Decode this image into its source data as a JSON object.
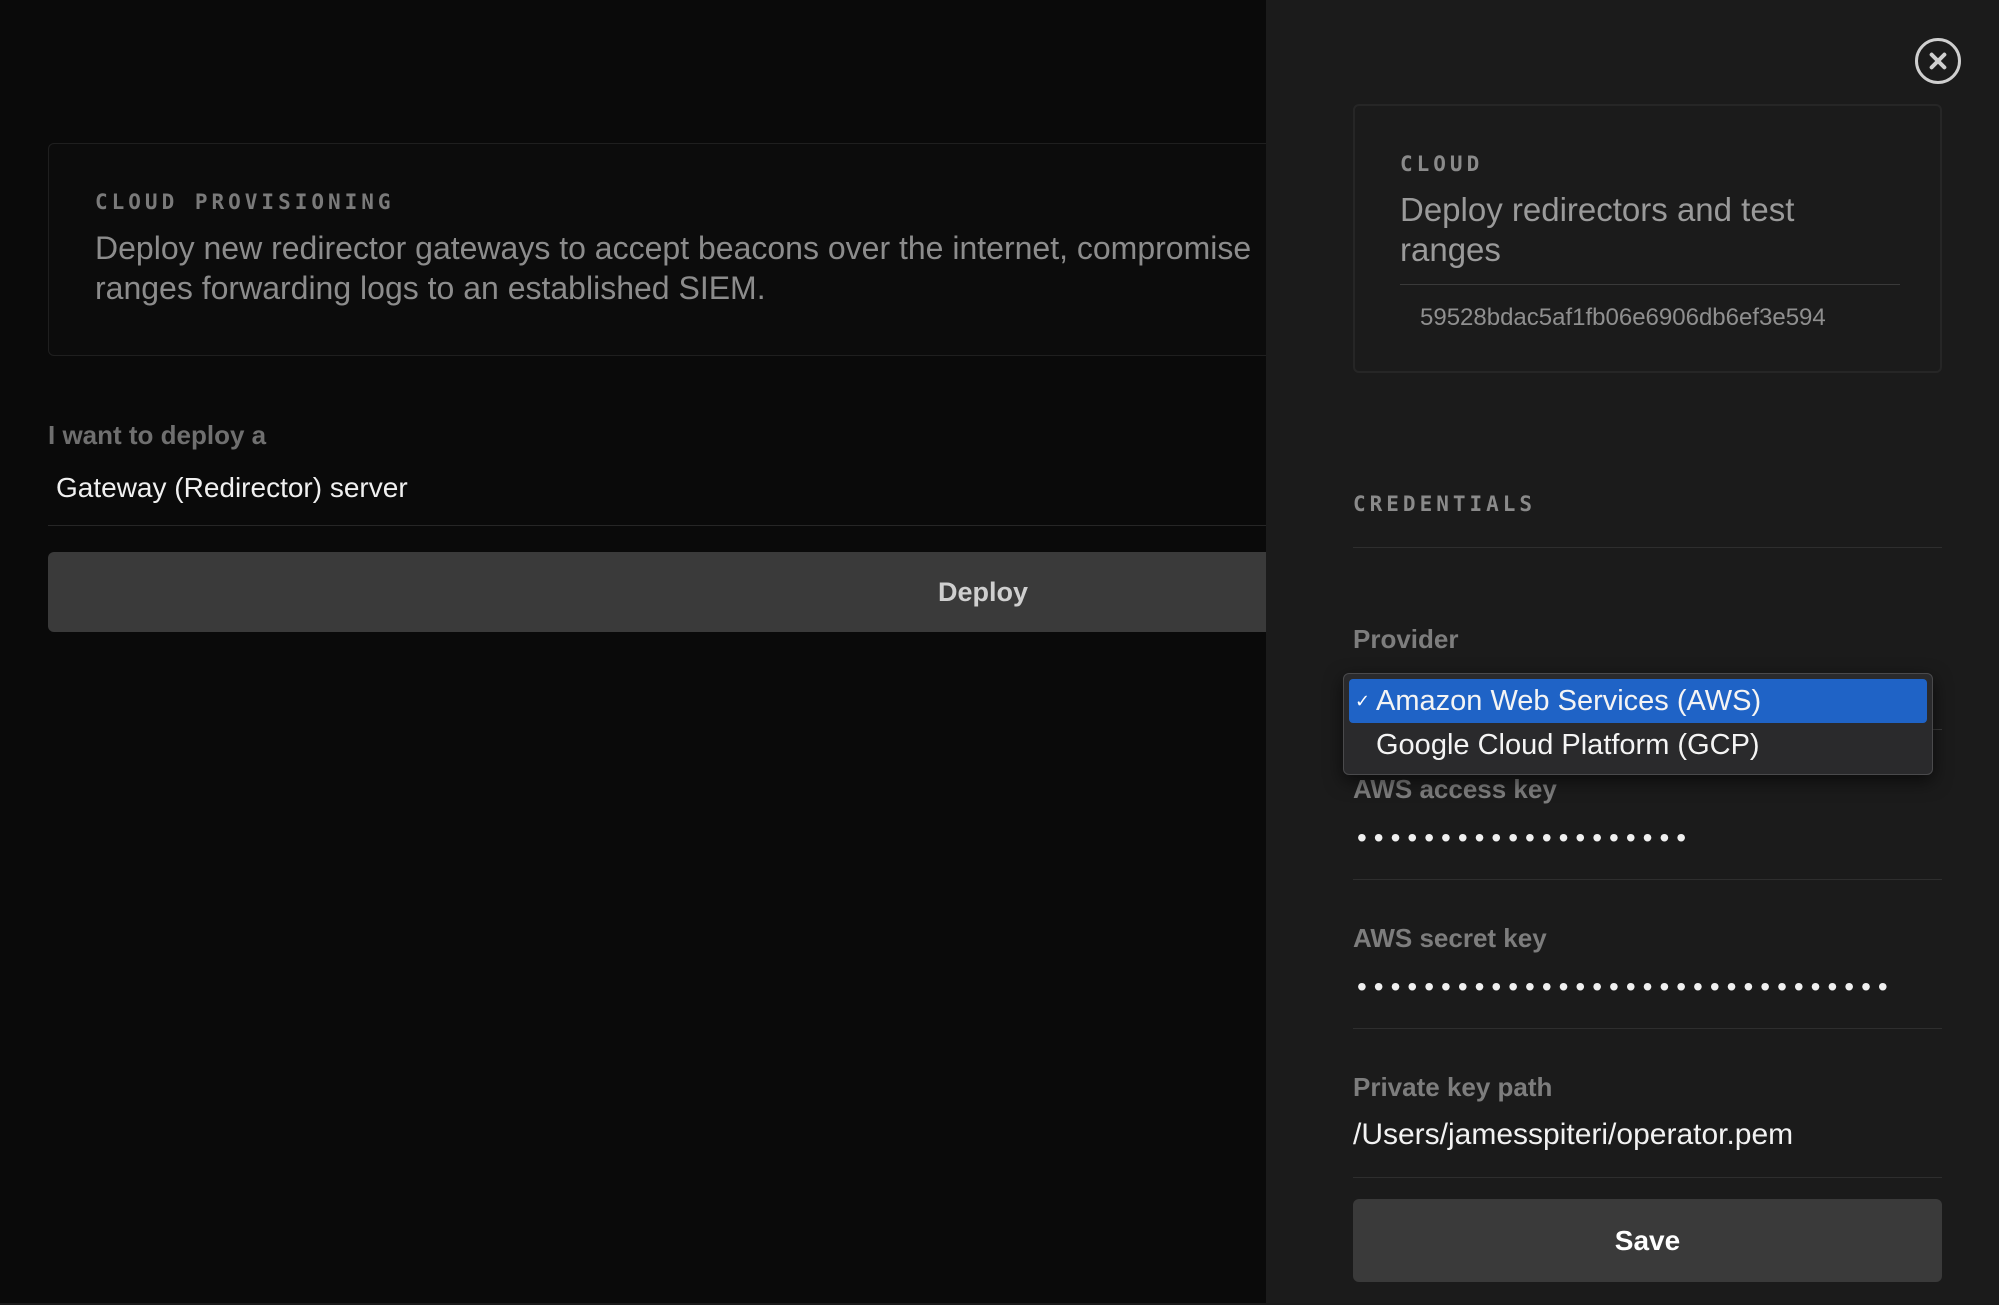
{
  "main": {
    "intro": {
      "eyebrow": "CLOUD PROVISIONING",
      "description": "Deploy new redirector gateways to accept beacons over the internet, compromise ranges forwarding logs to an established SIEM."
    },
    "deploy_label": "I want to deploy a",
    "deploy_type_value": "Gateway (Redirector) server",
    "deploy_button_label": "Deploy"
  },
  "drawer": {
    "cloud_card": {
      "eyebrow": "CLOUD",
      "title": "Deploy redirectors and test ranges",
      "id": "59528bdac5af1fb06e6906db6ef3e594"
    },
    "credentials_heading": "CREDENTIALS",
    "provider": {
      "label": "Provider",
      "options": [
        {
          "label": "Amazon Web Services (AWS)",
          "selected": true
        },
        {
          "label": "Google Cloud Platform (GCP)",
          "selected": false
        }
      ],
      "check_glyph": "✓"
    },
    "aws_access_key": {
      "label": "AWS access key",
      "masked_value": "••••••••••••••••••••"
    },
    "aws_secret_key": {
      "label": "AWS secret key",
      "masked_value": "••••••••••••••••••••••••••••••••"
    },
    "private_key_path": {
      "label": "Private key path",
      "value": "/Users/jamesspiteri/operator.pem"
    },
    "save_button_label": "Save",
    "close_icon": "close-circle-icon"
  },
  "colors": {
    "background": "#0a0a0a",
    "drawer_background": "#1b1b1b",
    "button_background": "#3a3a3a",
    "selection_blue": "#1f63c6"
  }
}
